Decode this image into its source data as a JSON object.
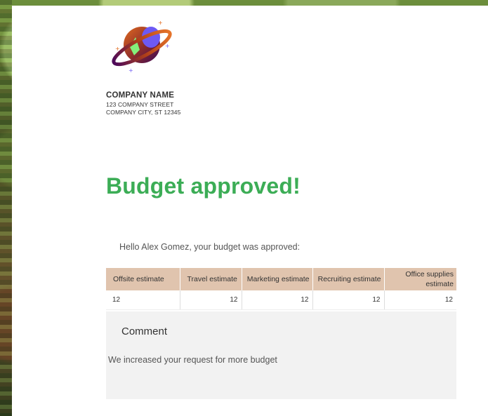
{
  "company": {
    "name": "COMPANY NAME",
    "street": "123 COMPANY STREET",
    "city_line": "COMPANY CITY, ST 12345"
  },
  "title": "Budget approved!",
  "greeting": "Hello Alex Gomez, your budget was approved:",
  "table": {
    "headers": [
      "Offsite estimate",
      "Travel estimate",
      "Marketing estimate",
      "Recruiting estimate",
      "Office supplies estimate"
    ],
    "values": [
      "12",
      "12",
      "12",
      "12",
      "12"
    ]
  },
  "comment": {
    "title": "Comment",
    "text": "We increased your request for more budget"
  },
  "colors": {
    "title": "#3cad56",
    "table_header": "#e0c4ae",
    "comment_bg": "#f2f2f2"
  },
  "icons": {
    "logo": "planet-logo-icon"
  }
}
